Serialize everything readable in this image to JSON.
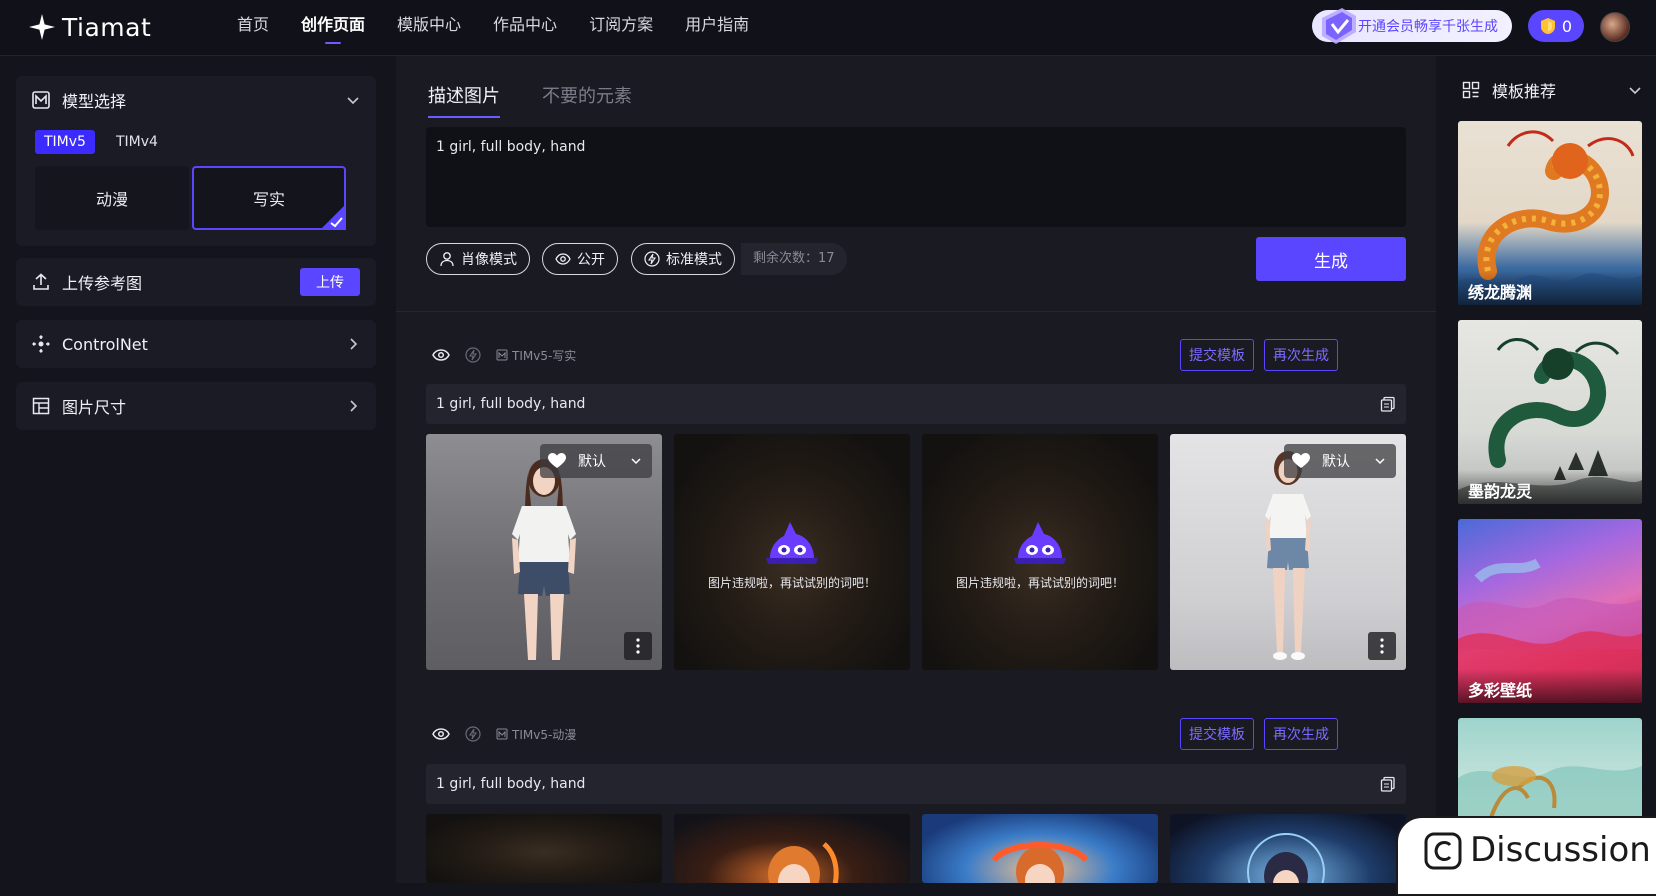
{
  "header": {
    "logo_text": "Tiamat",
    "nav": [
      "首页",
      "创作页面",
      "模版中心",
      "作品中心",
      "订阅方案",
      "用户指南"
    ],
    "active_nav": "创作页面",
    "vip_text": "开通会员畅享千张生成",
    "coin_count": "0"
  },
  "left_panel": {
    "model_title": "模型选择",
    "model_tabs": [
      "TIMv5",
      "TIMv4"
    ],
    "styles": [
      "动漫",
      "写实"
    ],
    "upload_title": "上传参考图",
    "upload_button": "上传",
    "controlnet_title": "ControlNet",
    "size_title": "图片尺寸"
  },
  "prompt_area": {
    "tabs": [
      "描述图片",
      "不要的元素"
    ],
    "prompt_text": "1 girl, full body, hand",
    "pill_portrait": "肖像模式",
    "pill_public": "公开",
    "pill_standard": "标准模式",
    "remaining": "剩余次数：17",
    "generate_button": "生成"
  },
  "results": [
    {
      "model_tag": "TIMv5-写实",
      "submit_label": "提交模板",
      "regen_label": "再次生成",
      "prompt": "1 girl, full body, hand",
      "default_label": "默认",
      "blocked_text": "图片违规啦，再试试别的词吧！"
    },
    {
      "model_tag": "TIMv5-动漫",
      "submit_label": "提交模板",
      "regen_label": "再次生成",
      "prompt": "1 girl, full body, hand"
    }
  ],
  "right_panel": {
    "title": "模板推荐",
    "templates": [
      "绣龙腾渊",
      "墨韵龙灵",
      "多彩壁纸"
    ]
  },
  "discussion_label": "Discussion",
  "colors": {
    "accent": "#5a46ff",
    "bg": "#14141d",
    "panel": "#1b1b26"
  }
}
